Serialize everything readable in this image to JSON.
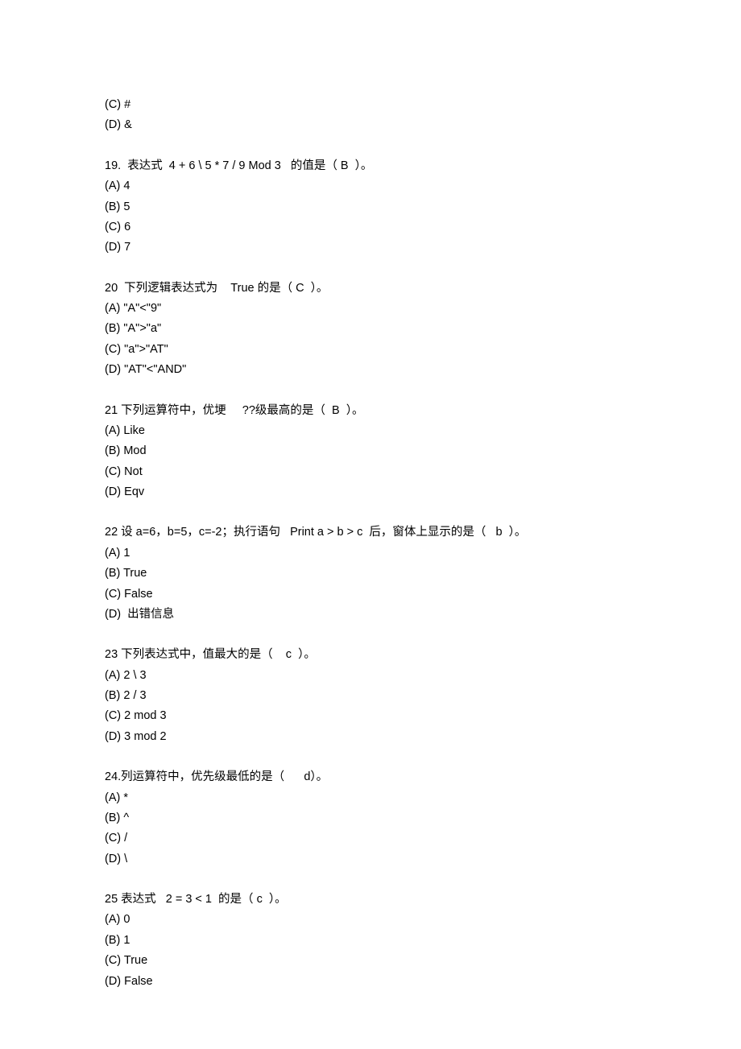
{
  "blocks": [
    {
      "lines": [
        "(C) #",
        "(D) &"
      ]
    },
    {
      "lines": [
        "19.  表达式  4 + 6 \\ 5 * 7 / 9 Mod 3   的值是（ B  ）。",
        "(A) 4",
        "(B) 5",
        "(C) 6",
        "(D) 7"
      ]
    },
    {
      "lines": [
        "20  下列逻辑表达式为    True 的是（ C  ）。",
        "(A) \"A\"<\"9\"",
        "(B) \"A\">\"a\"",
        "(C) \"a\">\"AT\"",
        "(D) \"AT\"<\"AND\""
      ]
    },
    {
      "lines": [
        "21 下列运算符中，优埂     ??级最高的是（  B  ）。",
        "(A) Like",
        "(B) Mod",
        "(C) Not",
        "(D) Eqv"
      ]
    },
    {
      "lines": [
        "22 设 a=6，b=5，c=-2；执行语句   Print a > b > c  后，窗体上显示的是（   b  ）。",
        "(A) 1",
        "(B) True",
        "(C) False",
        "(D)  出错信息"
      ]
    },
    {
      "lines": [
        "23 下列表达式中，值最大的是（    c  ）。",
        "(A) 2 \\ 3",
        "(B) 2 / 3",
        "(C) 2 mod 3",
        "(D) 3 mod 2"
      ]
    },
    {
      "lines": [
        "24.列运算符中，优先级最低的是（      d）。",
        "(A) *",
        "(B) ^",
        "(C) /",
        "(D) \\"
      ]
    },
    {
      "lines": [
        "25 表达式   2 = 3 < 1  的是（ c  ）。",
        "(A) 0",
        "(B) 1",
        "(C) True",
        "(D) False"
      ]
    }
  ]
}
